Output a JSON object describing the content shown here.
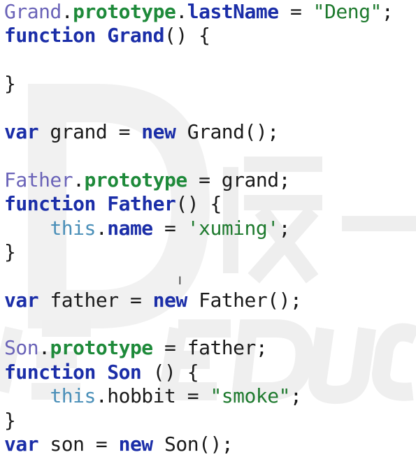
{
  "code_lines": [
    [
      {
        "t": "Grand",
        "c": "cls"
      },
      {
        "t": ".",
        "c": "op"
      },
      {
        "t": "prototype",
        "c": "prop"
      },
      {
        "t": ".",
        "c": "op"
      },
      {
        "t": "lastName",
        "c": "kw"
      },
      {
        "t": " = ",
        "c": "op"
      },
      {
        "t": "\"Deng\"",
        "c": "str"
      },
      {
        "t": ";",
        "c": "op"
      }
    ],
    [
      {
        "t": "function",
        "c": "kw"
      },
      {
        "t": " ",
        "c": "op"
      },
      {
        "t": "Grand",
        "c": "fn"
      },
      {
        "t": "() {",
        "c": "op"
      }
    ],
    [],
    [
      {
        "t": "}",
        "c": "op"
      }
    ],
    [],
    [
      {
        "t": "var",
        "c": "kw"
      },
      {
        "t": " grand = ",
        "c": "op"
      },
      {
        "t": "new",
        "c": "kw"
      },
      {
        "t": " Grand();",
        "c": "op"
      }
    ],
    [],
    [
      {
        "t": "Father",
        "c": "cls"
      },
      {
        "t": ".",
        "c": "op"
      },
      {
        "t": "prototype",
        "c": "prop"
      },
      {
        "t": " = grand;",
        "c": "op"
      }
    ],
    [
      {
        "t": "function",
        "c": "kw"
      },
      {
        "t": " ",
        "c": "op"
      },
      {
        "t": "Father",
        "c": "fn"
      },
      {
        "t": "() {",
        "c": "op"
      }
    ],
    [
      {
        "t": "    ",
        "c": "op"
      },
      {
        "t": "this",
        "c": "thisk"
      },
      {
        "t": ".",
        "c": "op"
      },
      {
        "t": "name",
        "c": "kw"
      },
      {
        "t": " = ",
        "c": "op"
      },
      {
        "t": "'xuming'",
        "c": "str"
      },
      {
        "t": ";",
        "c": "op"
      }
    ],
    [
      {
        "t": "}",
        "c": "op"
      }
    ],
    [],
    [
      {
        "t": "var",
        "c": "kw"
      },
      {
        "t": " father = ",
        "c": "op"
      },
      {
        "t": "new",
        "c": "kw"
      },
      {
        "t": " Father();",
        "c": "op"
      }
    ],
    [],
    [
      {
        "t": "Son",
        "c": "cls"
      },
      {
        "t": ".",
        "c": "op"
      },
      {
        "t": "prototype",
        "c": "prop"
      },
      {
        "t": " = father;",
        "c": "op"
      }
    ],
    [
      {
        "t": "function",
        "c": "kw"
      },
      {
        "t": " ",
        "c": "op"
      },
      {
        "t": "Son",
        "c": "fn"
      },
      {
        "t": " () {",
        "c": "op"
      }
    ],
    [
      {
        "t": "    ",
        "c": "op"
      },
      {
        "t": "this",
        "c": "thisk"
      },
      {
        "t": ".hobbit = ",
        "c": "op"
      },
      {
        "t": "\"smoke\"",
        "c": "str"
      },
      {
        "t": ";",
        "c": "op"
      }
    ],
    [
      {
        "t": "}",
        "c": "op"
      }
    ],
    [
      {
        "t": "var",
        "c": "kw"
      },
      {
        "t": " son = ",
        "c": "op"
      },
      {
        "t": "new",
        "c": "kw"
      },
      {
        "t": " Son();",
        "c": "op"
      }
    ]
  ],
  "cursor_glyph": "I",
  "colors": {
    "keyword": "#1b2ea8",
    "class_name": "#6a63b8",
    "property": "#1e8a3a",
    "string": "#1e7a2e",
    "this": "#4a8fb8",
    "text": "#1a1a1a",
    "background": "#ffffff"
  }
}
